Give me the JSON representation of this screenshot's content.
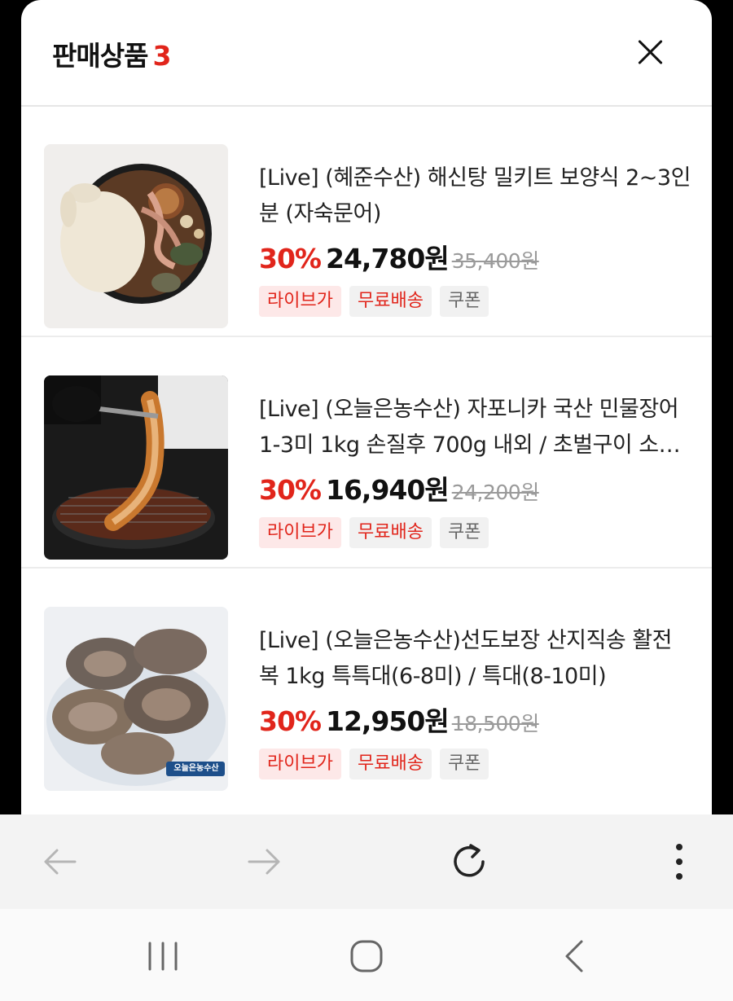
{
  "header": {
    "title": "판매상품",
    "count": "3"
  },
  "products": [
    {
      "name": "[Live] (혜준수산) 해신탕 밀키트 보양식 2~3인분 (자숙문어)",
      "discount": "30%",
      "price": "24,780원",
      "original": "35,400원",
      "badges": [
        "라이브가",
        "무료배송",
        "쿠폰"
      ]
    },
    {
      "name": "[Live] (오늘은농수산) 자포니카 국산 민물장어 1-3미 1kg 손질후 700g 내외 / 초벌구이 소스 포함",
      "discount": "30%",
      "price": "16,940원",
      "original": "24,200원",
      "badges": [
        "라이브가",
        "무료배송",
        "쿠폰"
      ]
    },
    {
      "name": "[Live] (오늘은농수산)선도보장 산지직송 활전복 1kg 특특대(6-8미) / 특대(8-10미)",
      "discount": "30%",
      "price": "12,950원",
      "original": "18,500원",
      "badges": [
        "라이브가",
        "무료배송",
        "쿠폰"
      ],
      "image_caption": "오늘은농수산"
    }
  ],
  "browser_bar": {
    "icons": [
      "back-arrow-icon",
      "forward-arrow-icon",
      "reload-icon",
      "more-vertical-icon"
    ]
  },
  "system_nav": {
    "icons": [
      "recent-apps-icon",
      "home-icon",
      "back-icon"
    ]
  }
}
